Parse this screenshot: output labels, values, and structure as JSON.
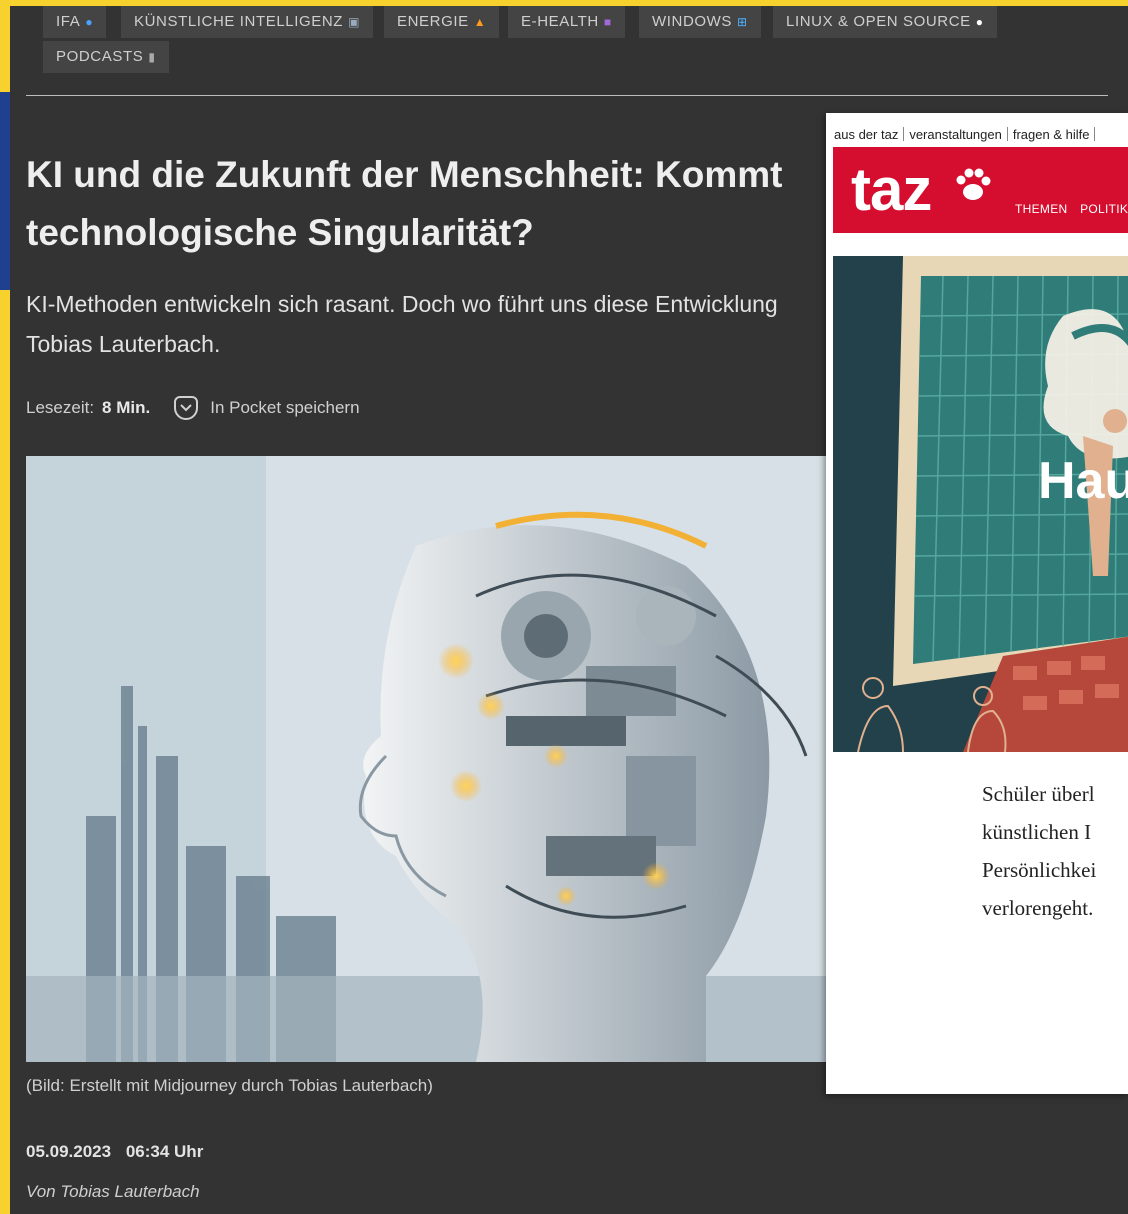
{
  "nav": {
    "tags": [
      {
        "label": "IFA",
        "icon": "circle-blue-icon"
      },
      {
        "label": "KÜNSTLICHE INTELLIGENZ",
        "icon": "robot-icon"
      },
      {
        "label": "ENERGIE",
        "icon": "fire-icon"
      },
      {
        "label": "E-HEALTH",
        "icon": "medical-icon"
      },
      {
        "label": "WINDOWS",
        "icon": "windows-icon"
      },
      {
        "label": "LINUX & OPEN SOURCE",
        "icon": "penguin-icon"
      },
      {
        "label": "PODCASTS",
        "icon": "microphone-icon"
      }
    ]
  },
  "article": {
    "title_line1": "KI und die Zukunft der Menschheit: Kommt",
    "title_line2": "technologische Singularität?",
    "lead_line1": "KI-Methoden entwickeln sich rasant. Doch wo führt uns diese Entwicklung",
    "lead_line2": "Tobias Lauterbach.",
    "reading_label": "Lesezeit:",
    "reading_value": "8 Min.",
    "pocket_label": "In Pocket speichern",
    "caption": "(Bild: Erstellt mit Midjourney durch Tobias Lauterbach)",
    "date": "05.09.2023",
    "time": "06:34 Uhr",
    "author": "Von Tobias Lauterbach"
  },
  "taz": {
    "toplinks": [
      "aus der taz",
      "veranstaltungen",
      "fragen & hilfe"
    ],
    "logo": "taz",
    "nav": [
      "THEMEN",
      "POLITIK"
    ],
    "headline_fragment": "Hau",
    "text_lines": [
      "Schüler überl",
      "künstlichen I",
      "Persönlichkei",
      "verlorengeht."
    ]
  },
  "colors": {
    "panel": "#333333",
    "frame": "#f7d22e",
    "taz_red": "#d50d2e"
  }
}
